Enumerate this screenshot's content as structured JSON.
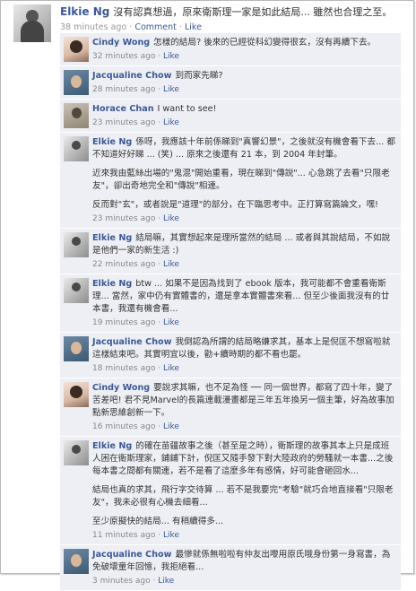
{
  "post": {
    "author": "Elkie Ng",
    "text": "沒有認真想過，原來衛斯理一家是如此結局... 雖然也合理之至。",
    "time": "38 minutes ago",
    "comment_link": "Comment",
    "like_link": "Like",
    "sep": "·"
  },
  "comments": [
    {
      "author": "Cindy Wong",
      "avatar": "cindy",
      "paragraphs": [
        "怎樣的結局? 後來的已經從科幻變得很玄，沒有再續下去。"
      ],
      "time": "32 minutes ago",
      "like": "Like"
    },
    {
      "author": "Jacqualine Chow",
      "avatar": "jacq",
      "paragraphs": [
        "到而家先睇?"
      ],
      "time": "28 minutes ago",
      "like": "Like"
    },
    {
      "author": "Horace Chan",
      "avatar": "horace",
      "paragraphs": [
        "I want to see!"
      ],
      "time": "23 minutes ago",
      "like": "Like"
    },
    {
      "author": "Elkie Ng",
      "avatar": "elkie",
      "paragraphs": [
        "係呀，我應該十年前係睇到\"真響幻景\"，之後就沒有機會看下去... 都不知道好好睇 ... (笑) ... 原來之後還有 21 本，到 2004 年封筆。",
        "近來我由藍絲出場的\"鬼混\"開始重看，現在睇到\"傳說\"... 心急跳了去看\"只限老友\"，卻出奇地完全和\"傳說\"相連。",
        "反而對\"玄\"，或者說是\"道理\"的部分，在下臨思考中。正打算寫篇論文，嘿!"
      ],
      "time": "23 minutes ago",
      "like": "Like"
    },
    {
      "author": "Elkie Ng",
      "avatar": "elkie",
      "paragraphs": [
        "結局嘛，其實想起來是理所當然的結局 ... 或者與其說結局，不如說是他們一家的新生活 :)"
      ],
      "time": "22 minutes ago",
      "like": "Like"
    },
    {
      "author": "Elkie Ng",
      "avatar": "elkie",
      "paragraphs": [
        "btw ... 如果不是因為找到了 ebook 版本，我可能都不會重看衛斯理... 當然，家中仍有實體書的，還是拿本實體書來看... 但至少後面我沒有的廿本書，我還有機會看..."
      ],
      "time": "19 minutes ago",
      "like": "Like"
    },
    {
      "author": "Jacqualine Chow",
      "avatar": "jacq",
      "paragraphs": [
        "我倒認為所謂的結局略嫌求其，基本上是倪匡不想寫啦就這樣結束吧。其實明宜以後，勸+續時期的都不看也罷。"
      ],
      "time": "18 minutes ago",
      "like": "Like"
    },
    {
      "author": "Cindy Wong",
      "avatar": "cindy",
      "paragraphs": [
        "要說求其嘛，也不足為怪 ── 同一個世界，都寫了四十年，變了苦差吧! 君不見Marvel的長篇連載漫畫都是三年五年換另一個主筆，好為故事加點新思維創新一下。"
      ],
      "time": "16 minutes ago",
      "like": "Like"
    },
    {
      "author": "Elkie Ng",
      "avatar": "elkie",
      "paragraphs": [
        "的確在苗疆故事之後（甚至是之時），衛斯理的故事其本上只是成班人困在衛斯理家，鋪鋪下計，倪匡又隨手發下對大陸政府的勞騷就一本書...之後每本書之間都有關連，若不是看了這麼多年有感情，好可能會砸回水...",
        "結局也真的求其，飛行字交待算 ... 若不是我要完\"考驗\"就巧合地直接看\"只限老友\"，我未必很有心機去細看...",
        "至少原擬快的結局... 有稍續得多..."
      ],
      "time": "11 minutes ago",
      "like": "Like"
    },
    {
      "author": "Jacqualine Chow",
      "avatar": "jacq",
      "paragraphs": [
        "最慘就係無啦啦有仲友出嚟用原氏哦身份第一身寫書，為免破壞童年回憶，我拒絕看..."
      ],
      "time": "3 minutes ago",
      "like": "Like"
    }
  ]
}
